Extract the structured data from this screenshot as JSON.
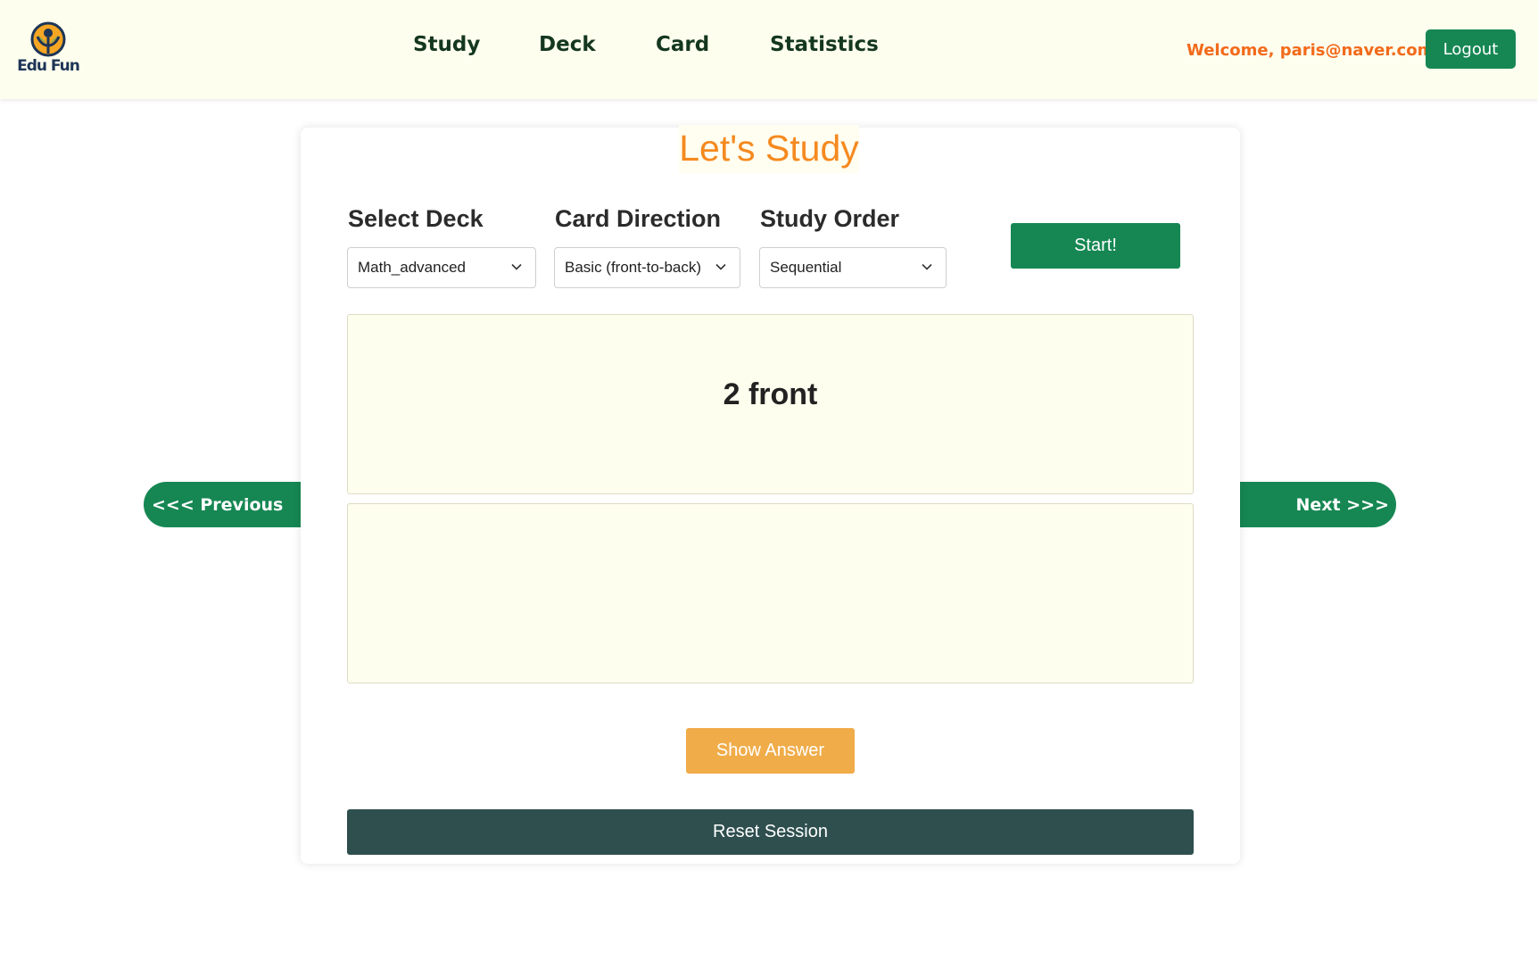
{
  "header": {
    "logo_text": "Edu Fun",
    "nav": {
      "study": "Study",
      "deck": "Deck",
      "card": "Card",
      "statistics": "Statistics"
    },
    "welcome": "Welcome,  paris@naver.com!",
    "logout_label": "Logout"
  },
  "colors": {
    "primary_green": "#168753",
    "accent_orange": "#f5891f",
    "welcome_orange": "#f26a1b",
    "show_answer": "#f0ac49",
    "reset_dark": "#2f4f4f",
    "card_bg": "#fefeee"
  },
  "study": {
    "title": "Let's Study",
    "deck_label": "Select Deck",
    "deck_value": "Math_advanced",
    "direction_label": "Card Direction",
    "direction_value": "Basic (front-to-back)",
    "order_label": "Study Order",
    "order_value": "Sequential",
    "start_label": "Start!",
    "card_front_text": "2 front",
    "card_back_text": "",
    "show_answer_label": "Show Answer",
    "reset_label": "Reset Session",
    "prev_label": "<<< Previous",
    "next_label": "Next >>>"
  },
  "icons": {
    "logo": "edu-fun-logo-icon",
    "dropdown": "chevron-down-icon"
  }
}
